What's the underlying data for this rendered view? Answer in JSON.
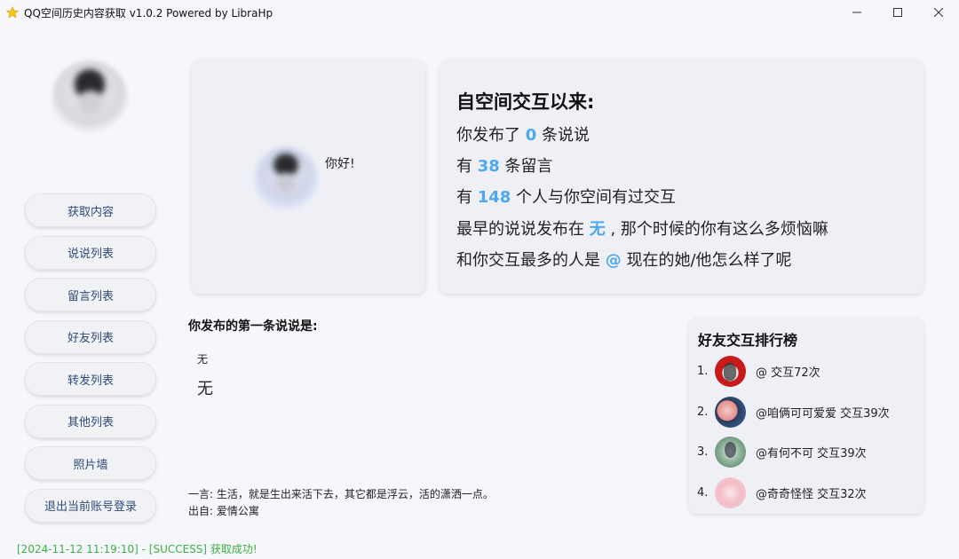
{
  "window": {
    "title": "QQ空间历史内容获取 v1.0.2 Powered by LibraHp",
    "controls": {
      "minimize": "—",
      "maximize": "☐",
      "close": "✕"
    }
  },
  "sidebar": {
    "items": [
      {
        "label": "获取内容"
      },
      {
        "label": "说说列表"
      },
      {
        "label": "留言列表"
      },
      {
        "label": "好友列表"
      },
      {
        "label": "转发列表"
      },
      {
        "label": "其他列表"
      },
      {
        "label": "照片墙"
      },
      {
        "label": "退出当前账号登录"
      }
    ]
  },
  "profile": {
    "greeting": "你好!"
  },
  "stats": {
    "title": "自空间交互以来:",
    "line1": {
      "prefix": "你发布了 ",
      "value": "0",
      "suffix": " 条说说"
    },
    "line2": {
      "prefix": "有 ",
      "value": "38",
      "suffix": " 条留言"
    },
    "line3": {
      "prefix": "有 ",
      "value": "148",
      "suffix": " 个人与你空间有过交互"
    },
    "line4": {
      "prefix": "最早的说说发布在 ",
      "value": "无",
      "suffix": " ,  那个时候的你有这么多烦恼嘛"
    },
    "line5": {
      "prefix": "和你交互最多的人是 ",
      "value": "@",
      "suffix": " 现在的她/他怎么样了呢"
    }
  },
  "first_post": {
    "label": "你发布的第一条说说是:",
    "small_text": "无",
    "large_text": "无"
  },
  "quote": {
    "text": "一言: 生活，就是生出来活下去，其它都是浮云，活的潇洒一点。",
    "source": "出自: 爱情公寓"
  },
  "ranking": {
    "title": "好友交互排行榜",
    "items": [
      {
        "rank": "1.",
        "text": "@ 交互72次"
      },
      {
        "rank": "2.",
        "text": "@咱俩可可爱爱 交互39次"
      },
      {
        "rank": "3.",
        "text": "@有何不可 交互39次"
      },
      {
        "rank": "4.",
        "text": "@奇奇怪怪 交互32次"
      }
    ]
  },
  "status": {
    "text": "[2024-11-12 11:19:10] - [SUCCESS] 获取成功!",
    "color": "#3cb043"
  },
  "colors": {
    "highlight": "#4ea8f0",
    "nav_text": "#2f4a7a",
    "background": "#f6f7fb"
  }
}
